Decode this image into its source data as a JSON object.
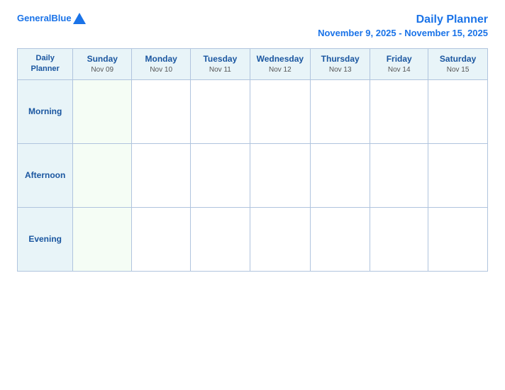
{
  "logo": {
    "text_general": "General",
    "text_blue": "Blue"
  },
  "title": {
    "main": "Daily Planner",
    "date_range": "November 9, 2025 - November 15, 2025"
  },
  "header_col": {
    "label": "Daily\nPlanner"
  },
  "days": [
    {
      "name": "Sunday",
      "date": "Nov 09"
    },
    {
      "name": "Monday",
      "date": "Nov 10"
    },
    {
      "name": "Tuesday",
      "date": "Nov 11"
    },
    {
      "name": "Wednesday",
      "date": "Nov 12"
    },
    {
      "name": "Thursday",
      "date": "Nov 13"
    },
    {
      "name": "Friday",
      "date": "Nov 14"
    },
    {
      "name": "Saturday",
      "date": "Nov 15"
    }
  ],
  "rows": [
    {
      "label": "Morning"
    },
    {
      "label": "Afternoon"
    },
    {
      "label": "Evening"
    }
  ]
}
